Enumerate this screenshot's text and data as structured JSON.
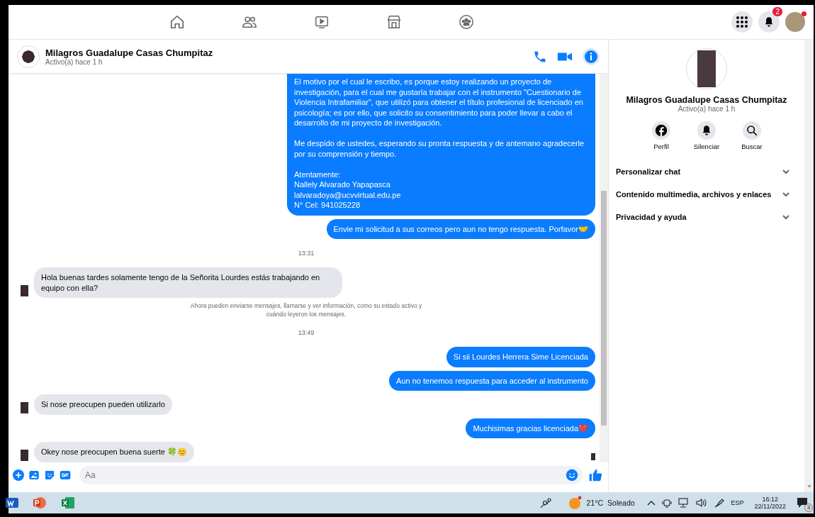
{
  "nav": {
    "tabs": [
      {
        "kind": "home"
      },
      {
        "kind": "friends"
      },
      {
        "kind": "watch"
      },
      {
        "kind": "marketplace"
      },
      {
        "kind": "groups"
      }
    ],
    "notification_count": "2"
  },
  "chat_header": {
    "name": "Milagros Guadalupe Casas Chumpitaz",
    "status": "Activo(a) hace 1 h"
  },
  "messages": [
    {
      "kind": "out",
      "text": "El motivo por el cual le escribo, es porque estoy realizando un proyecto de investigación, para el cual me gustaría trabajar con el instrumento \"Cuestionario de Violencia Intrafamiliar\",  que utilizó para obtener el título profesional de licenciado en psicología; es por ello, que solicito su consentimiento para poder llevar a cabo el desarrollo de mi proyecto de investigación.\n\nMe despido de ustedes, esperando su pronta respuesta y de antemano agradecerle por su comprensión y tiempo.\n\nAtentamente:\nNallely Alvarado Yapapasca\nlalvaradoya@ucvvirtual.edu.pe\nN° Cel: 941025228"
    },
    {
      "kind": "out",
      "text": "Envie mi solicitud a sus correos pero aun no tengo respuesta. Porfavor🤝"
    },
    {
      "kind": "time",
      "text": "13:31"
    },
    {
      "kind": "in",
      "text": "Hola buenas tardes solamente tengo de la Señorita Lourdes estás trabajando en equipo con ella?"
    },
    {
      "kind": "notice",
      "text": "Ahora pueden enviarse mensajes, llamarse y ver información, como su estado activo y cuándo leyeron los mensajes."
    },
    {
      "kind": "time",
      "text": "13:49"
    },
    {
      "kind": "out",
      "text": "Si sii Lourdes Herrera Sime Licenciada"
    },
    {
      "kind": "out",
      "text": "Aun no tenemos respuesta para acceder al instrumento"
    },
    {
      "kind": "in",
      "text": "Si nose preocupen pueden utilizarlo"
    },
    {
      "kind": "out",
      "text": "Muchisimas gracias licenciada❤️"
    },
    {
      "kind": "in",
      "text": "Okey nose preocupen buena suerte 🍀😊"
    }
  ],
  "composer": {
    "placeholder": "Aa"
  },
  "profile": {
    "name": "Milagros Guadalupe Casas Chumpitaz",
    "status": "Activo(a) hace 1 h",
    "actions": [
      {
        "kind": "facebook",
        "label": "Perfil"
      },
      {
        "kind": "bell",
        "label": "Silenciar"
      },
      {
        "kind": "search",
        "label": "Buscar"
      }
    ],
    "sections": [
      {
        "label": "Personalizar chat",
        "expanded": false
      },
      {
        "label": "Contenido multimedia, archivos y enlaces",
        "expanded": false
      },
      {
        "label": "Privacidad y ayuda",
        "expanded": false
      }
    ]
  },
  "taskbar": {
    "apps": [
      {
        "kind": "word"
      },
      {
        "kind": "powerpoint"
      },
      {
        "kind": "excel"
      }
    ],
    "temperature": "21°C",
    "weather": "Soleado",
    "language": "ESP",
    "time": "16:12",
    "date": "22/11/2022",
    "notification_count": "3"
  }
}
